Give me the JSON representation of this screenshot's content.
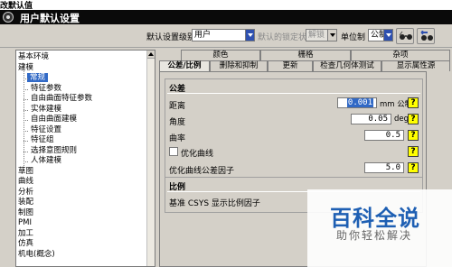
{
  "top_strip": {
    "text": "改默认值"
  },
  "window": {
    "title": "用户默认设置"
  },
  "toolbar": {
    "level_label": "默认设置级别",
    "level_value": "用户",
    "lock_label": "默认的锁定状态",
    "lock_value": "解锁",
    "unit_label": "单位制",
    "unit_value": "公制"
  },
  "tree": {
    "items": [
      {
        "label": "基本环境",
        "level": 0
      },
      {
        "label": "建模",
        "level": 0
      },
      {
        "label": "常规",
        "level": 1,
        "selected": true
      },
      {
        "label": "特征参数",
        "level": 1
      },
      {
        "label": "自由曲面特征参数",
        "level": 1
      },
      {
        "label": "实体建模",
        "level": 1
      },
      {
        "label": "自由曲面建模",
        "level": 1
      },
      {
        "label": "特征设置",
        "level": 1
      },
      {
        "label": "特征组",
        "level": 1
      },
      {
        "label": "选择意图规则",
        "level": 1
      },
      {
        "label": "人体建模",
        "level": 1
      },
      {
        "label": "草图",
        "level": 0
      },
      {
        "label": "曲线",
        "level": 0
      },
      {
        "label": "分析",
        "level": 0
      },
      {
        "label": "装配",
        "level": 0
      },
      {
        "label": "制图",
        "level": 0
      },
      {
        "label": "PMI",
        "level": 0
      },
      {
        "label": "加工",
        "level": 0
      },
      {
        "label": "仿真",
        "level": 0
      },
      {
        "label": "机电(概念)",
        "level": 0
      }
    ]
  },
  "tabs": {
    "row1": [
      "颜色",
      "栅格",
      "杂项"
    ],
    "row2": [
      "公差/比例",
      "删除和抑制",
      "更新",
      "检查几何体测试",
      "显示属性源"
    ]
  },
  "tolerance": {
    "title": "公差",
    "distance_label": "距离",
    "distance_value": "0.001",
    "distance_unit": "mm 公制",
    "angle_label": "角度",
    "angle_value": "0.05",
    "angle_unit": "deg",
    "curvature_label": "曲率",
    "curvature_value": "0.5",
    "optimize_label": "优化曲线",
    "optimize_factor_label": "优化曲线公差因子",
    "optimize_factor_value": "5.0",
    "help": "?"
  },
  "scale": {
    "title": "比例",
    "csys_label": "基准 CSYS 显示比例因子"
  },
  "watermark": {
    "brand": "百科全说",
    "slogan": "助你轻松解决"
  },
  "colors": {
    "selection": "#3169c6",
    "help_button": "#ffff00",
    "titlebar": "#0a0a0a",
    "brand": "#1e5fb3"
  }
}
